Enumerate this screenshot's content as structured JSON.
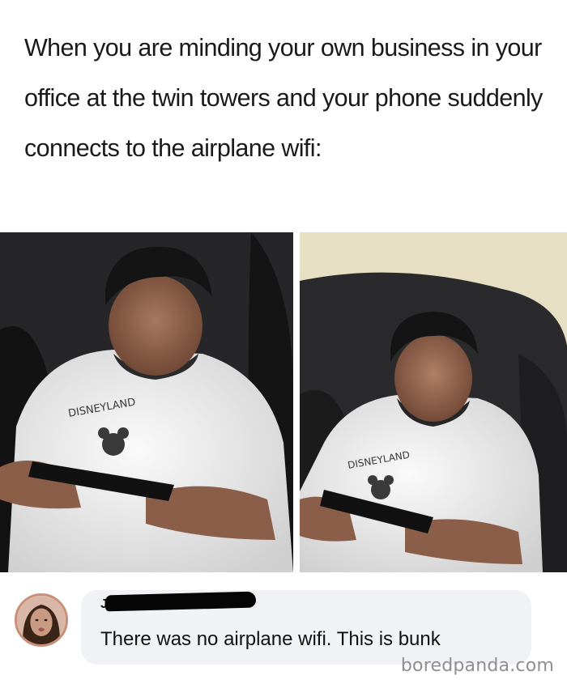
{
  "meme": {
    "caption": "When you are minding your own business in your office at the twin towers and your phone suddenly connects to the airplane wifi:"
  },
  "panels": [
    {
      "shirt_text": "DISNEYLAND"
    },
    {
      "shirt_text": "DISNEYLAND"
    }
  ],
  "comment": {
    "author_visible": "J",
    "text": "There was no airplane wifi. This is bunk"
  },
  "watermark": "boredpanda.com",
  "colors": {
    "redaction": "#050505",
    "bubble": "#f0f2f5",
    "shirt": "#eeeeee",
    "couch": "#2a2a2c",
    "wall": "#e6dfc3"
  }
}
